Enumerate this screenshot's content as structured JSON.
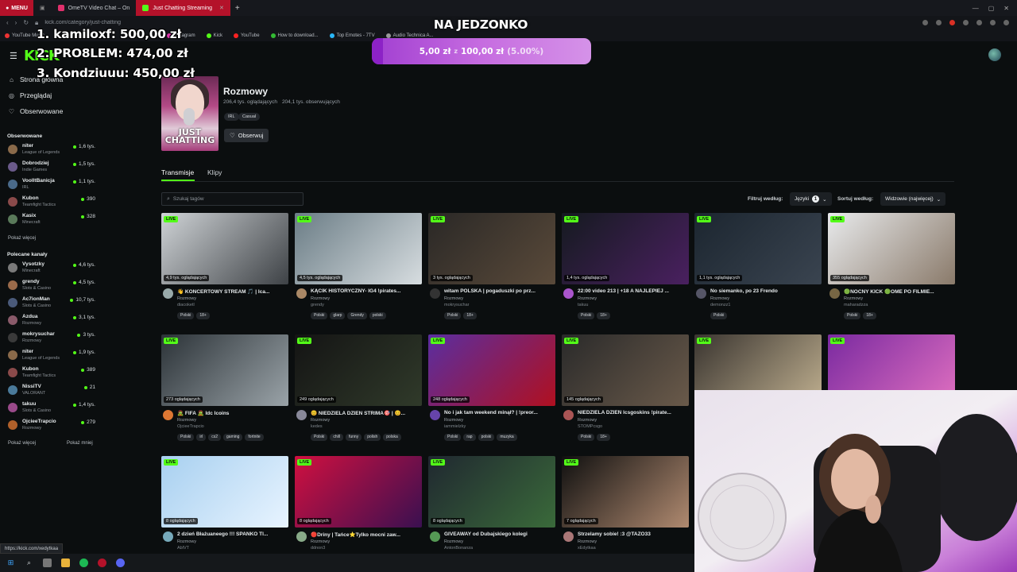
{
  "browser": {
    "menu_label": "MENU",
    "tabs": [
      {
        "label": "OmeTV Video Chat – On",
        "active": false
      },
      {
        "label": "Just Chatting Streaming",
        "active": true
      }
    ],
    "url": "kick.com/category/just-chatting",
    "bookmarks": [
      "YouTube Music",
      "Instagram",
      "Kick",
      "YouTube",
      "How to download...",
      "Top Emotes - 7TV",
      "Audio Technica A..."
    ],
    "status_url": "https://kick.com/xedytkaa"
  },
  "site": {
    "logo": "KICK"
  },
  "overlay": {
    "donors": [
      "1. kamiloxf: 500,00 zł",
      "2. PRO8LEM: 474,00 zł",
      "3. Kondziuuu: 450,00 zł"
    ],
    "goal_title": "NA JEDZONKO",
    "goal_current": "5,00 zł",
    "goal_sep": "z",
    "goal_target": "100,00 zł",
    "goal_percent": "(5.00%)",
    "goal_progress": 0.05
  },
  "sidebar": {
    "nav": [
      "Strona główna",
      "Przeglądaj",
      "Obserwowane"
    ],
    "followed_heading": "Obserwowane",
    "followed": [
      {
        "name": "niter",
        "category": "League of Legends",
        "viewers": "1,6 tys.",
        "color": "#8a6a4a"
      },
      {
        "name": "Dobrodziej",
        "category": "Indie Games",
        "viewers": "1,5 tys.",
        "color": "#6a5a8a"
      },
      {
        "name": "VoolltBanicja",
        "category": "IRL",
        "viewers": "1,1 tys.",
        "color": "#4a6a8a"
      },
      {
        "name": "Kubon",
        "category": "Teamfight Tactics",
        "viewers": "390",
        "color": "#8a4a4a"
      },
      {
        "name": "Kasix",
        "category": "Minecraft",
        "viewers": "328",
        "color": "#5a7a5a"
      }
    ],
    "show_more_followed": "Pokaż więcej",
    "recommended_heading": "Polecane kanały",
    "recommended": [
      {
        "name": "Vysotzky",
        "category": "Minecraft",
        "viewers": "4,6 tys.",
        "color": "#7a7a7a"
      },
      {
        "name": "grendy",
        "category": "Slots & Casino",
        "viewers": "4,5 tys.",
        "color": "#9a6a4a"
      },
      {
        "name": "Ac7ionMan",
        "category": "Slots & Casino",
        "viewers": "10,7 tys.",
        "color": "#4a5a7a"
      },
      {
        "name": "Azdua",
        "category": "Rozmowy",
        "viewers": "3,1 tys.",
        "color": "#8a5a6a"
      },
      {
        "name": "mokrysuchar",
        "category": "Rozmowy",
        "viewers": "3 tys.",
        "color": "#3a3a3a"
      },
      {
        "name": "niter",
        "category": "League of Legends",
        "viewers": "1,9 tys.",
        "color": "#8a6a4a"
      },
      {
        "name": "Kubon",
        "category": "Teamfight Tactics",
        "viewers": "389",
        "color": "#8a4a4a"
      },
      {
        "name": "NissiTV",
        "category": "VALORANT",
        "viewers": "21",
        "color": "#4a7a9a"
      },
      {
        "name": "takuu",
        "category": "Slots & Casino",
        "viewers": "1,4 tys.",
        "color": "#9a4a8a"
      },
      {
        "name": "OjcieeTrapcio",
        "category": "Rozmowy",
        "viewers": "279",
        "color": "#b0602a"
      }
    ],
    "show_more_recommended": "Pokaż więcej",
    "show_less": "Pokaż mniej"
  },
  "category": {
    "thumb_caption": "JUST CHATTING",
    "title": "Rozmowy",
    "viewers": "206,4 tys. oglądających",
    "followers": "204,1 tys. obserwujących",
    "tags": [
      "IRL",
      "Casual"
    ],
    "follow_label": "Obserwuj"
  },
  "tabs": [
    "Transmisje",
    "Klipy"
  ],
  "search": {
    "placeholder": "Szukaj tagów"
  },
  "filters": {
    "filter_label": "Filtruj według:",
    "language_label": "Języki",
    "language_count": "1",
    "sort_label": "Sortuj według:",
    "sort_value": "Widzowie (najwięcej)"
  },
  "streams": [
    {
      "title": "👋 KONCERTOWY STREAM 🎵 | Ica...",
      "category": "Rozmowy",
      "user": "diacoketl",
      "viewers": "4,9 tys. oglądających",
      "tags": [
        "Polski",
        "18+"
      ],
      "bg1": "#cfd3d6",
      "bg2": "#3e4246",
      "avatar": "#9aa"
    },
    {
      "title": "KĄCIK HISTORYCZNY- IG4 !pirates...",
      "category": "Rozmowy",
      "user": "grendy",
      "viewers": "4,5 tys. oglądających",
      "tags": [
        "Polski",
        "glarp",
        "Grendy",
        "polski"
      ],
      "bg1": "#6b7d86",
      "bg2": "#d7dde0",
      "avatar": "#a86"
    },
    {
      "title": "witam POLSKA | pogaduszki po prz...",
      "category": "Rozmowy",
      "user": "mokrysuchar",
      "viewers": "3 tys. oglądających",
      "tags": [
        "Polski",
        "18+"
      ],
      "bg1": "#2a2826",
      "bg2": "#5a4a3a",
      "avatar": "#333"
    },
    {
      "title": "22:00 video 213 | +18 A NAJLEPIEJ ...",
      "category": "Rozmowy",
      "user": "takuu",
      "viewers": "1,4 tys. oglądających",
      "tags": [
        "Polski",
        "18+"
      ],
      "bg1": "#151a20",
      "bg2": "#4a2060",
      "avatar": "#a5c"
    },
    {
      "title": "No siemanko, po 23 Frendo",
      "category": "Rozmowy",
      "user": "demonzz1",
      "viewers": "1,1 tys. oglądających",
      "tags": [
        "Polski"
      ],
      "bg1": "#1c2630",
      "bg2": "#3a4450",
      "avatar": "#556"
    },
    {
      "title": "🟢NOCNY KICK 🟢OME PO FILMIE...",
      "category": "Rozmowy",
      "user": "maharadzza",
      "viewers": "355 oglądających",
      "tags": [
        "Polski",
        "18+"
      ],
      "bg1": "#e8eaec",
      "bg2": "#8a7a6a",
      "avatar": "#764"
    },
    {
      "title": "🧟 FIFA 🧟 Idc Icoins",
      "category": "Rozmowy",
      "user": "OjcieeTrapcio",
      "viewers": "273 oglądających",
      "tags": [
        "Polski",
        "irl",
        "cs2",
        "gaming",
        "fortnite"
      ],
      "bg1": "#2c3338",
      "bg2": "#9aa3a8",
      "avatar": "#d73"
    },
    {
      "title": "😊 NIEDZIELA DZIEN STRIMA🎯 | 😊...",
      "category": "Rozmowy",
      "user": "kedes",
      "viewers": "249 oglądających",
      "tags": [
        "Polski",
        "chill",
        "funny",
        "polish",
        "polska"
      ],
      "bg1": "#141414",
      "bg2": "#303a2a",
      "avatar": "#889"
    },
    {
      "title": "No i jak tam weekend minął? | !preor...",
      "category": "Rozmowy",
      "user": "iammielzky",
      "viewers": "248 oglądających",
      "tags": [
        "Polski",
        "rap",
        "polski",
        "muzyka"
      ],
      "bg1": "#5a2ea0",
      "bg2": "#b01020",
      "avatar": "#64a"
    },
    {
      "title": "NIEDZIELA DZIEŃ Icsgoskins !pirate...",
      "category": "Rozmowy",
      "user": "STOMPcsgo",
      "viewers": "145 oglądających",
      "tags": [
        "Polski",
        "18+"
      ],
      "bg1": "#2a2a2a",
      "bg2": "#6a5a4a",
      "avatar": "#a55"
    },
    {
      "title": "",
      "category": "",
      "user": "",
      "viewers": "",
      "tags": [],
      "bg1": "#3a3530",
      "bg2": "#c0b090",
      "avatar": "#777"
    },
    {
      "title": "",
      "category": "",
      "user": "",
      "viewers": "",
      "tags": [],
      "bg1": "#7a2aa0",
      "bg2": "#e070c0",
      "avatar": "#777"
    },
    {
      "title": "2 dzień Błażuaneego !!! SPANKO TI...",
      "category": "Rozmowy",
      "user": "AblVT",
      "viewers": "8 oglądających",
      "tags": [],
      "bg1": "#a8d0f0",
      "bg2": "#e8f4ff",
      "avatar": "#7ab"
    },
    {
      "title": "🔴Driny | Tańce⭐Tylko mocni zaw...",
      "category": "Rozmowy",
      "user": "ddnon3",
      "viewers": "8 oglądających",
      "tags": [],
      "bg1": "#d01040",
      "bg2": "#3a1050",
      "avatar": "#8a8"
    },
    {
      "title": "GIVEAWAY od Dubajskiego kolegi",
      "category": "Rozmowy",
      "user": "AntonBonanza",
      "viewers": "8 oglądających",
      "tags": [],
      "bg1": "#202830",
      "bg2": "#3a6a3a",
      "avatar": "#595"
    },
    {
      "title": "Strzelamy sobie! :3 @TAZO33",
      "category": "Rozmowy",
      "user": "xEdytkaa",
      "viewers": "7 oglądających",
      "tags": [],
      "bg1": "#101010",
      "bg2": "#b08a70",
      "avatar": "#a77"
    }
  ],
  "live_label": "LIVE"
}
